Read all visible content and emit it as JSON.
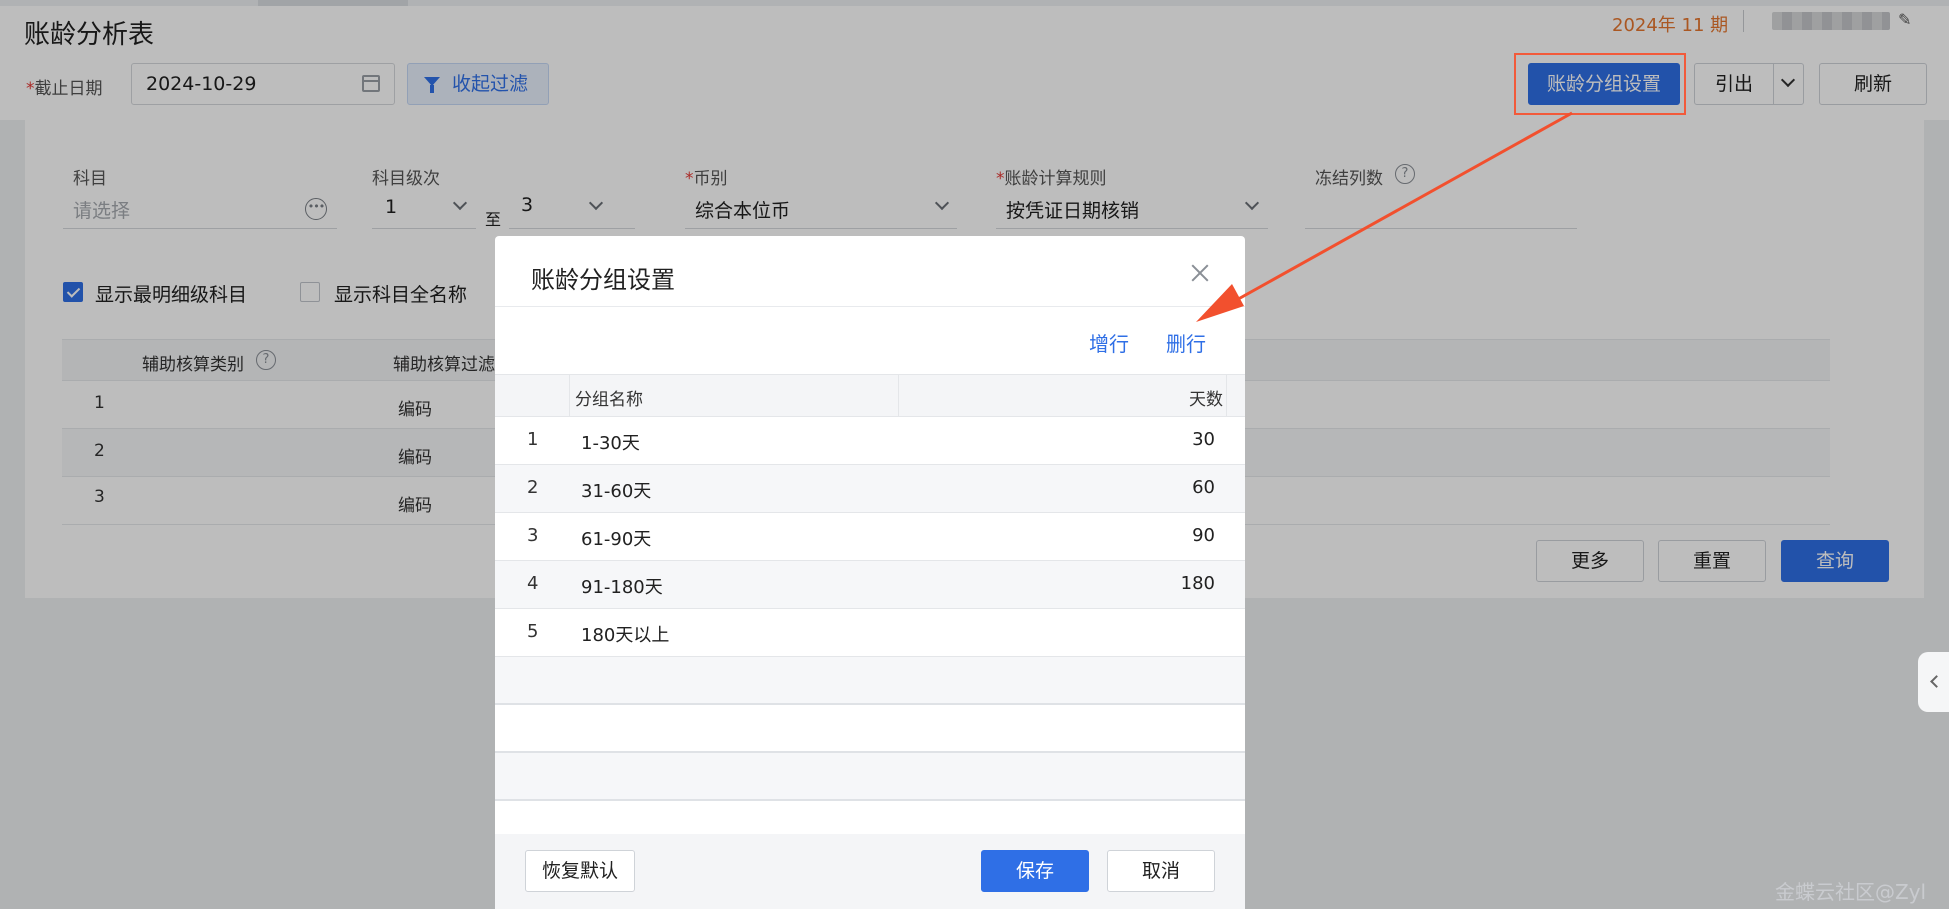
{
  "header": {
    "title": "账龄分析表",
    "period": "2024年 11 期"
  },
  "toolbar": {
    "cutoff_label": "截止日期",
    "cutoff_date": "2024-10-29",
    "collapse_filter": "收起过滤",
    "aging_group_settings": "账龄分组设置",
    "export": "引出",
    "refresh": "刷新"
  },
  "filters": {
    "subject": {
      "label": "科目",
      "placeholder": "请选择"
    },
    "subject_level": {
      "label": "科目级次",
      "from": "1",
      "to_word": "至",
      "to": "3"
    },
    "currency": {
      "label": "币别",
      "value": "综合本位币"
    },
    "aging_rule": {
      "label": "账龄计算规则",
      "value": "按凭证日期核销"
    },
    "freeze_cols": {
      "label": "冻结列数"
    },
    "show_lowest_level": {
      "label": "显示最明细级科目",
      "checked": true
    },
    "show_full_name": {
      "label": "显示科目全名称",
      "checked": false
    }
  },
  "aux_table": {
    "columns": [
      "辅助核算类别",
      "辅助核算过滤"
    ],
    "rows": [
      {
        "index": "1",
        "filter": "编码"
      },
      {
        "index": "2",
        "filter": "编码"
      },
      {
        "index": "3",
        "filter": "编码"
      }
    ]
  },
  "panel_buttons": {
    "more": "更多",
    "reset": "重置",
    "query": "查询"
  },
  "dialog": {
    "title": "账龄分组设置",
    "add_row": "增行",
    "delete_row": "删行",
    "columns": {
      "name": "分组名称",
      "days": "天数"
    },
    "rows": [
      {
        "index": "1",
        "name": "1-30天",
        "days": "30"
      },
      {
        "index": "2",
        "name": "31-60天",
        "days": "60"
      },
      {
        "index": "3",
        "name": "61-90天",
        "days": "90"
      },
      {
        "index": "4",
        "name": "91-180天",
        "days": "180"
      },
      {
        "index": "5",
        "name": "180天以上",
        "days": ""
      }
    ],
    "restore_default": "恢复默认",
    "save": "保存",
    "cancel": "取消"
  },
  "watermark": "金蝶云社区@Zyl",
  "colors": {
    "primary": "#2f6fe6",
    "highlight": "#f25a3a",
    "period": "#e6762e"
  }
}
